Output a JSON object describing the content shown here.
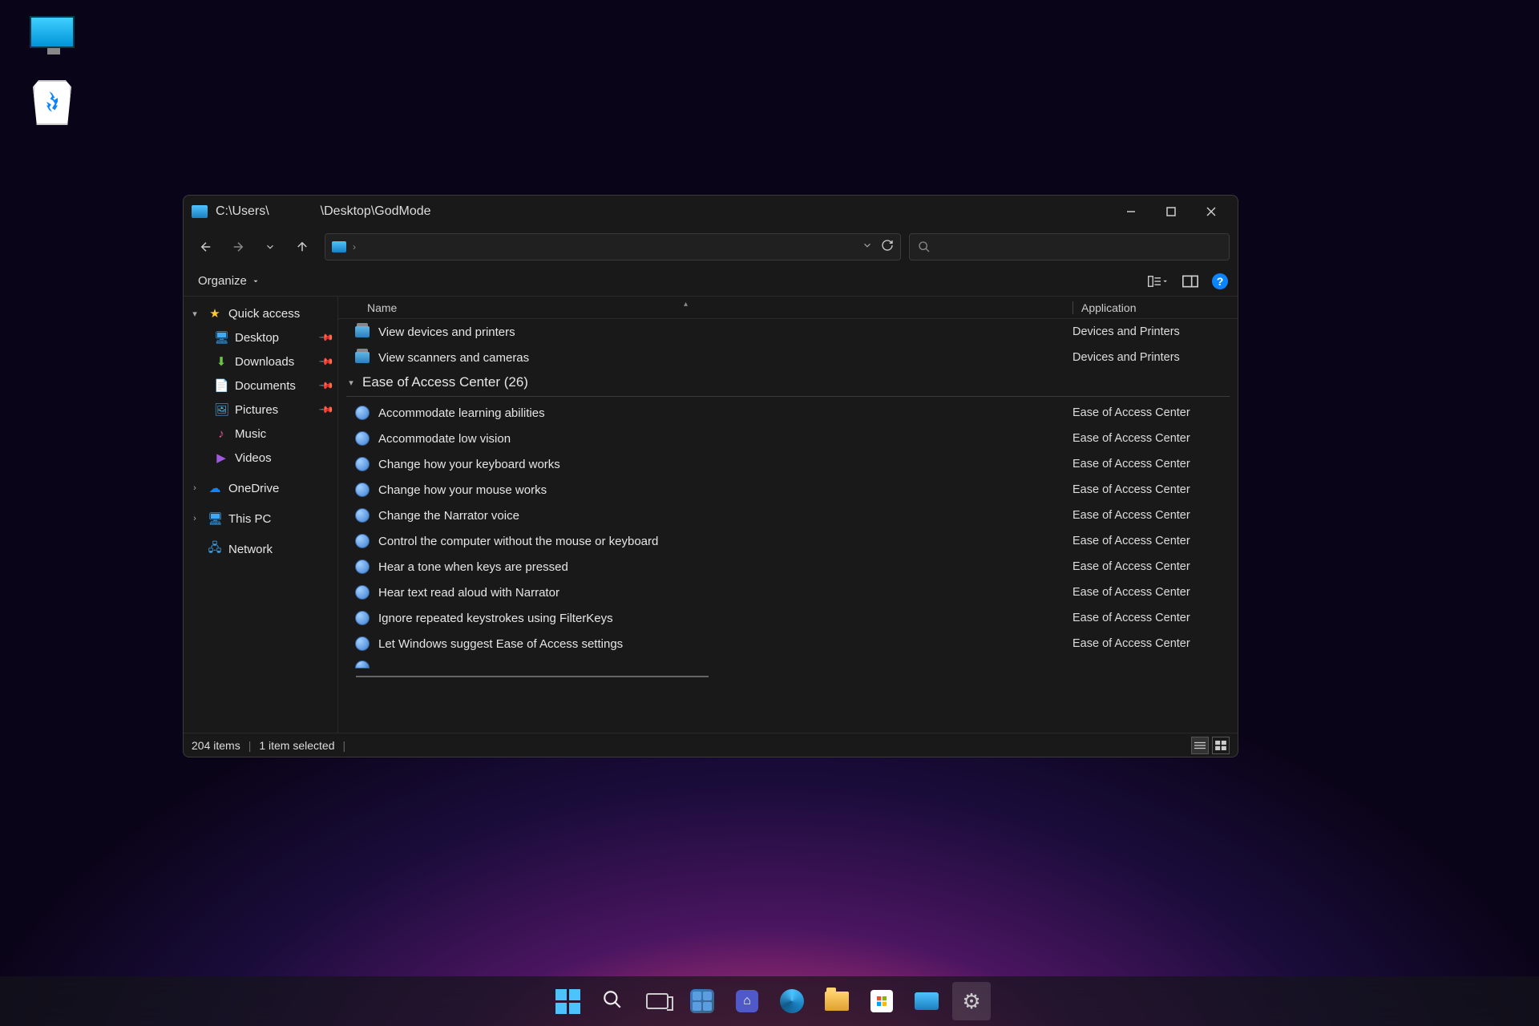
{
  "window": {
    "title_prefix": "C:\\Users\\",
    "title_suffix": "\\Desktop\\GodMode",
    "breadcrumb_sep": "›"
  },
  "toolbar": {
    "organize": "Organize"
  },
  "sidebar": {
    "quick_access": "Quick access",
    "desktop": "Desktop",
    "downloads": "Downloads",
    "documents": "Documents",
    "pictures": "Pictures",
    "music": "Music",
    "videos": "Videos",
    "onedrive": "OneDrive",
    "this_pc": "This PC",
    "network": "Network"
  },
  "columns": {
    "name": "Name",
    "application": "Application"
  },
  "group": {
    "ease_label": "Ease of Access Center (26)"
  },
  "rows": [
    {
      "name": "View devices and printers",
      "app": "Devices and Printers",
      "kind": "cp"
    },
    {
      "name": "View scanners and cameras",
      "app": "Devices and Printers",
      "kind": "cp"
    }
  ],
  "ease_rows": [
    {
      "name": "Accommodate learning abilities",
      "app": "Ease of Access Center"
    },
    {
      "name": "Accommodate low vision",
      "app": "Ease of Access Center"
    },
    {
      "name": "Change how your keyboard works",
      "app": "Ease of Access Center"
    },
    {
      "name": "Change how your mouse works",
      "app": "Ease of Access Center"
    },
    {
      "name": "Change the Narrator voice",
      "app": "Ease of Access Center"
    },
    {
      "name": "Control the computer without the mouse or keyboard",
      "app": "Ease of Access Center"
    },
    {
      "name": "Hear a tone when keys are pressed",
      "app": "Ease of Access Center"
    },
    {
      "name": "Hear text read aloud with Narrator",
      "app": "Ease of Access Center"
    },
    {
      "name": "Ignore repeated keystrokes using FilterKeys",
      "app": "Ease of Access Center"
    },
    {
      "name": "Let Windows suggest Ease of Access settings",
      "app": "Ease of Access Center"
    }
  ],
  "status": {
    "items": "204 items",
    "selected": "1 item selected"
  }
}
